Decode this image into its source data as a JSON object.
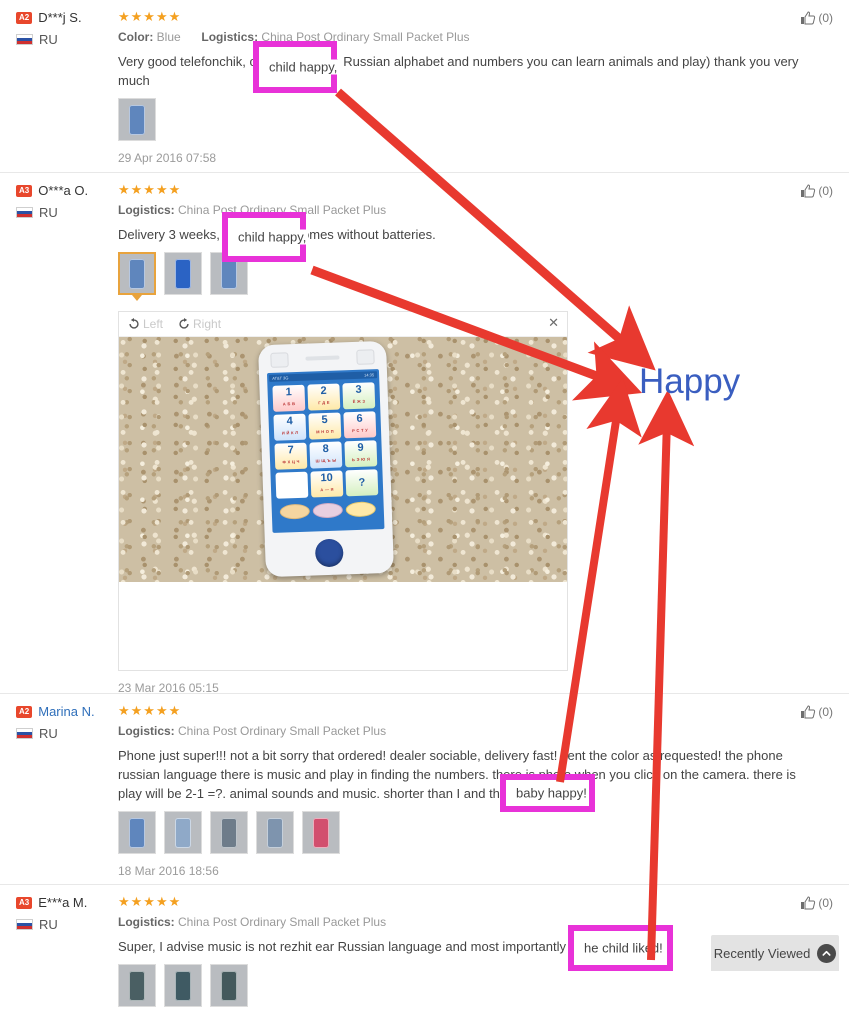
{
  "reviews": [
    {
      "badge": "A2",
      "user": "D***j S.",
      "user_is_link": false,
      "country": "RU",
      "stars": "★★★★★",
      "color_label": "Color:",
      "color_value": "Blue",
      "logistics_label": "Logistics:",
      "logistics_value": "China Post Ordinary Small Packet Plus",
      "text": "Very good telefonchik, child happy, the Russian alphabet and numbers you can learn animals and play) thank you very much",
      "date": "29 Apr 2016 07:58",
      "likes": "(0)",
      "thumbs": 1
    },
    {
      "badge": "A3",
      "user": "O***a O.",
      "user_is_link": false,
      "country": "RU",
      "stars": "★★★★★",
      "logistics_label": "Logistics:",
      "logistics_value": "China Post Ordinary Small Packet Plus",
      "text": "Delivery 3 weeks, child happy, comes without batteries.",
      "date": "23 Mar 2016 05:15",
      "likes": "(0)",
      "thumbs": 3,
      "viewer": {
        "rotate_left": "Left",
        "rotate_right": "Right",
        "close": "✕",
        "photo_alt": "Toy phone with number keypad lying on beige carpet"
      }
    },
    {
      "badge": "A2",
      "user": "Marina N.",
      "user_is_link": true,
      "country": "RU",
      "stars": "★★★★★",
      "logistics_label": "Logistics:",
      "logistics_value": "China Post Ordinary Small Packet Plus",
      "text": "Phone just super!!! not a bit sorry that ordered! dealer sociable, delivery fast! sent the color as requested! the phone russian language there is music and play in finding the numbers. there is photo when you click on the camera. there is play will be 2-1 =?. animal sounds and music. shorter than I and the baby happy!",
      "date": "18 Mar 2016 18:56",
      "likes": "(0)",
      "thumbs": 5
    },
    {
      "badge": "A3",
      "user": "E***a M.",
      "user_is_link": false,
      "country": "RU",
      "stars": "★★★★★",
      "logistics_label": "Logistics:",
      "logistics_value": "China Post Ordinary Small Packet Plus",
      "text": "Super, I advise music is not rezhit ear Russian language and most importantly the child liked!",
      "likes": "(0)",
      "thumbs": 3
    }
  ],
  "annotations": {
    "highlight_color": "#e832d8",
    "arrow_color": "#e8392f",
    "callout_color": "#3a5ec0",
    "callout_text": "Happy",
    "boxes": [
      {
        "text": "child happy,"
      },
      {
        "text": "child happy,"
      },
      {
        "text": "baby happy!"
      },
      {
        "text": "he child liked!"
      }
    ]
  },
  "recently_viewed": {
    "label": "Recently Viewed",
    "icon": "chevron-up-icon"
  },
  "toy_phone": {
    "status_left": "AT&T 3G",
    "status_time": "14:35",
    "keys": [
      {
        "num": "1",
        "sub": "А Б В"
      },
      {
        "num": "2",
        "sub": "Г Д Е"
      },
      {
        "num": "3",
        "sub": "Ё Ж З"
      },
      {
        "num": "4",
        "sub": "И Й К Л"
      },
      {
        "num": "5",
        "sub": "М Н О П"
      },
      {
        "num": "6",
        "sub": "Р С Т У"
      },
      {
        "num": "7",
        "sub": "Ф Х Ц Ч"
      },
      {
        "num": "8",
        "sub": "Ш Щ Ъ Ы"
      },
      {
        "num": "9",
        "sub": "Ь Э Ю Я"
      },
      {
        "num": "",
        "sub": ""
      },
      {
        "num": "10",
        "sub": "А — Я"
      },
      {
        "num": "?",
        "sub": ""
      }
    ]
  }
}
